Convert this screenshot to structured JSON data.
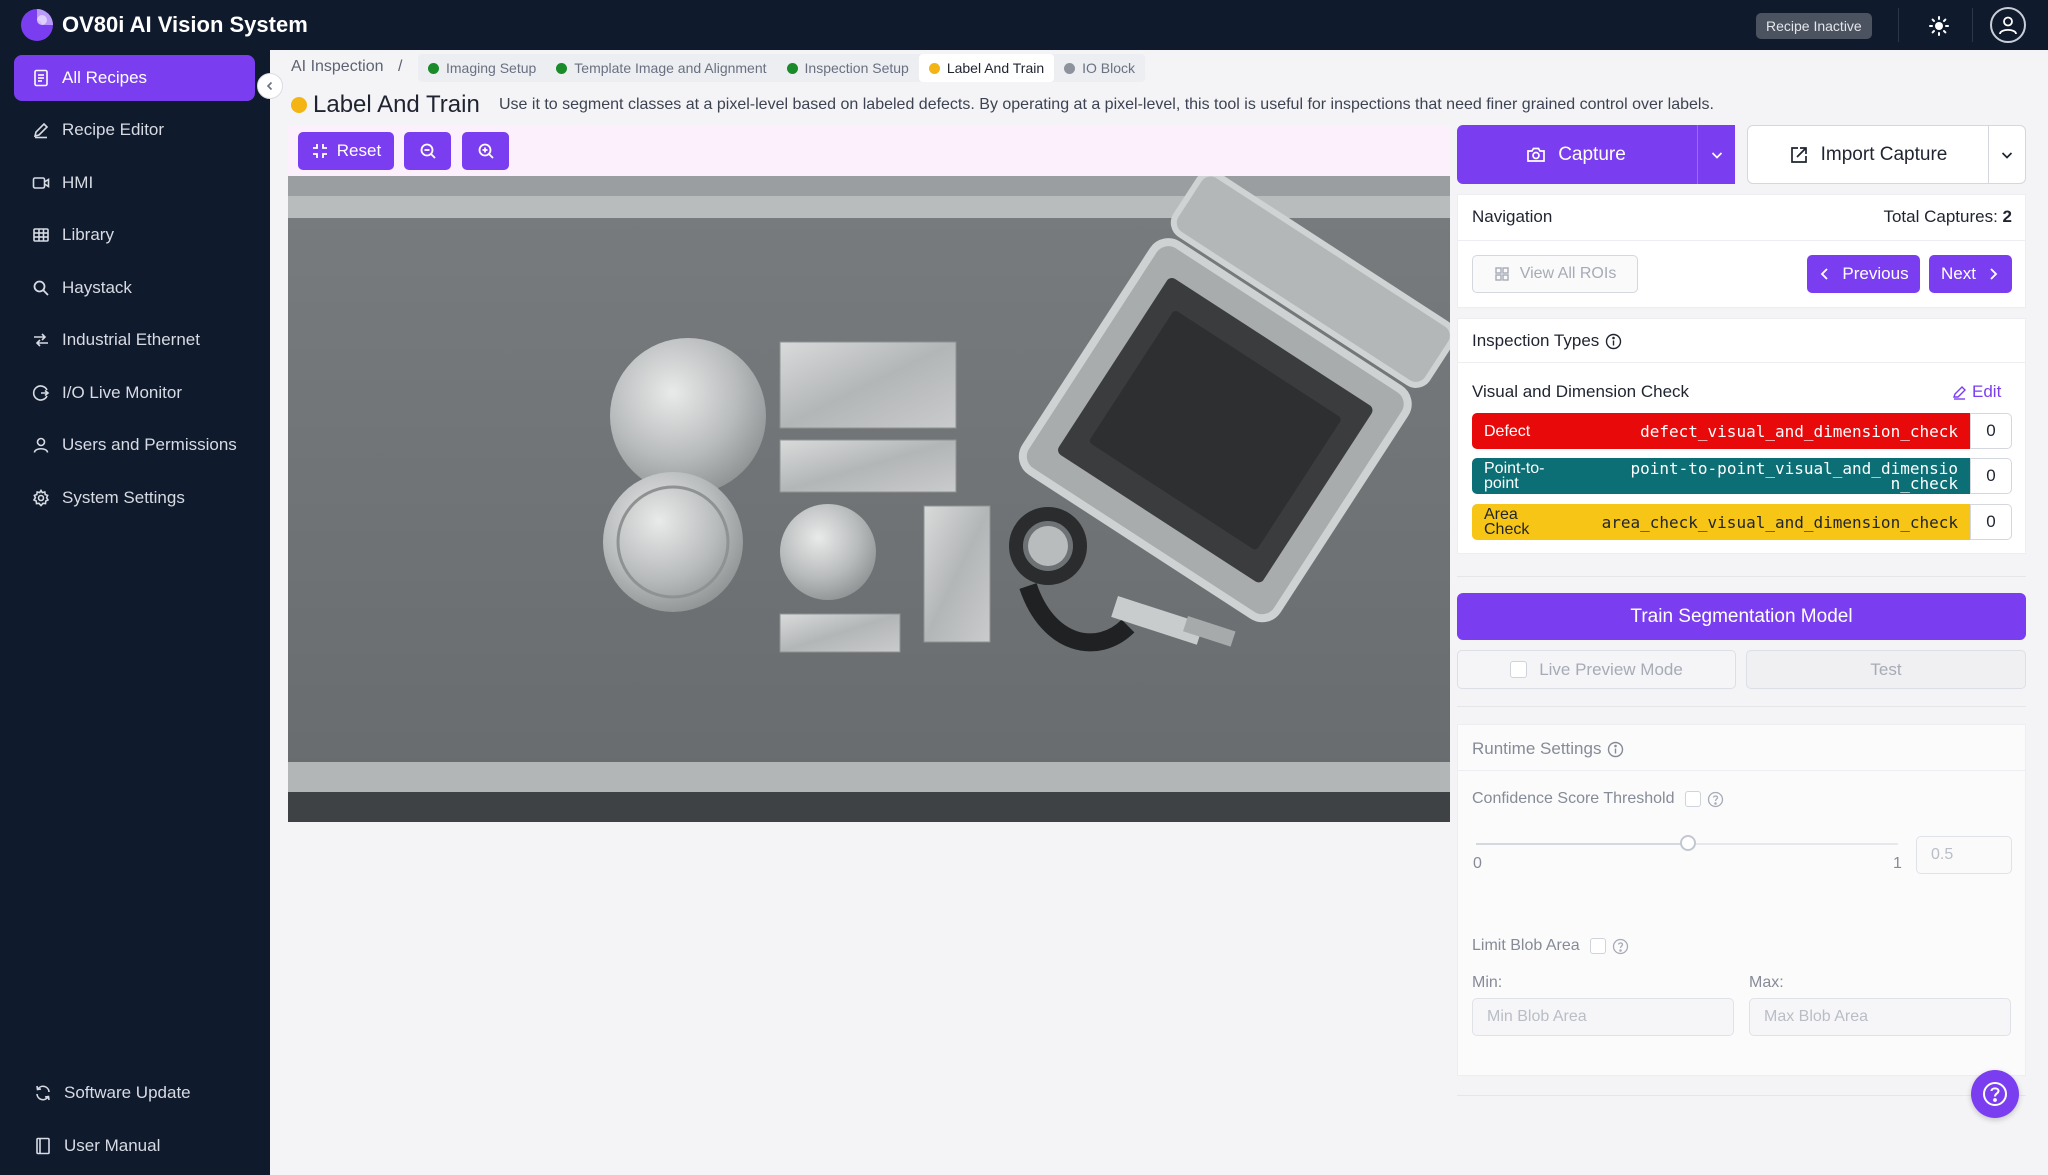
{
  "app": {
    "title": "OV80i AI Vision System",
    "status_badge": "Recipe Inactive"
  },
  "sidebar": {
    "items": [
      {
        "label": "All Recipes",
        "icon": "document-icon",
        "active": true
      },
      {
        "label": "Recipe Editor",
        "icon": "pencil-icon"
      },
      {
        "label": "HMI",
        "icon": "video-icon"
      },
      {
        "label": "Library",
        "icon": "grid-icon"
      },
      {
        "label": "Haystack",
        "icon": "search-icon"
      },
      {
        "label": "Industrial Ethernet",
        "icon": "ethernet-icon"
      },
      {
        "label": "I/O Live Monitor",
        "icon": "monitor-icon"
      },
      {
        "label": "Users and Permissions",
        "icon": "user-icon"
      },
      {
        "label": "System Settings",
        "icon": "gear-icon"
      }
    ],
    "footer": [
      {
        "label": "Software Update",
        "icon": "refresh-icon"
      },
      {
        "label": "User Manual",
        "icon": "book-icon"
      }
    ]
  },
  "breadcrumb": {
    "root": "AI Inspection",
    "separator": "/",
    "steps": [
      {
        "label": "Imaging Setup",
        "color": "#1a8a2a"
      },
      {
        "label": "Template Image and Alignment",
        "color": "#1a8a2a"
      },
      {
        "label": "Inspection Setup",
        "color": "#1a8a2a"
      },
      {
        "label": "Label And Train",
        "color": "#f3b414",
        "active": true
      },
      {
        "label": "IO Block",
        "color": "#8d929c"
      }
    ]
  },
  "page": {
    "title": "Label And Train",
    "description": "Use it to segment classes at a pixel-level based on labeled defects. By operating at a pixel-level, this tool is useful for inspections that need finer grained control over labels."
  },
  "toolbar": {
    "reset_label": "Reset"
  },
  "capture": {
    "capture_label": "Capture",
    "import_label": "Import Capture"
  },
  "navigation": {
    "title": "Navigation",
    "total_label": "Total Captures:",
    "total_value": "2",
    "view_all": "View All ROIs",
    "previous": "Previous",
    "next": "Next"
  },
  "inspection_types": {
    "title": "Inspection Types",
    "check_name": "Visual and Dimension Check",
    "edit_label": "Edit",
    "types": [
      {
        "name": "Defect",
        "key": "defect_visual_and_dimension_check",
        "count": "0",
        "color": "#e8090b",
        "text": "#ffffff"
      },
      {
        "name": "Point-to-point",
        "key": "point-to-point_visual_and_dimension_check",
        "count": "0",
        "color": "#0b6f75",
        "text": "#ffffff"
      },
      {
        "name": "Area Check",
        "key": "area_check_visual_and_dimension_check",
        "count": "0",
        "color": "#f6c516",
        "text": "#1f2430"
      }
    ]
  },
  "train": {
    "train_label": "Train Segmentation Model",
    "live_preview": "Live Preview Mode",
    "test_label": "Test"
  },
  "runtime": {
    "title": "Runtime Settings",
    "confidence_label": "Confidence Score Threshold",
    "slider_min": "0",
    "slider_max": "1",
    "confidence_value": "0.5",
    "slider_fraction": 0.5,
    "blob_label": "Limit Blob Area",
    "min_label": "Min:",
    "max_label": "Max:",
    "min_placeholder": "Min Blob Area",
    "max_placeholder": "Max Blob Area"
  },
  "colors": {
    "accent": "#7a3ef0",
    "sidebar_bg": "#0f1a2c"
  }
}
